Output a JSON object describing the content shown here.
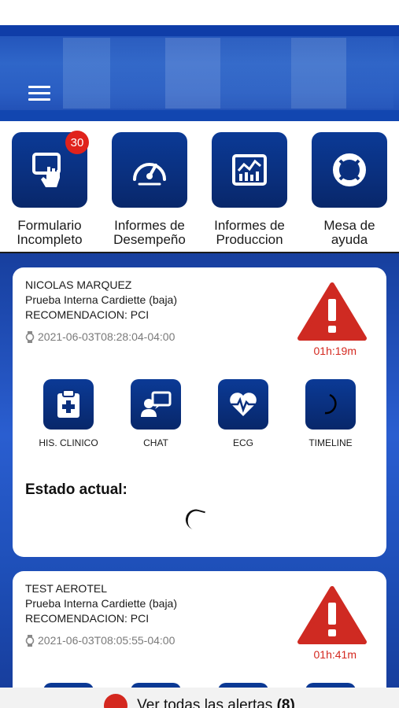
{
  "header": {
    "menu_icon": "hamburger-menu-icon"
  },
  "quick_actions": [
    {
      "label_line1": "Formulario",
      "label_line2": "Incompleto",
      "icon": "touch-form-icon",
      "badge": "30"
    },
    {
      "label_line1": "Informes de",
      "label_line2": "Desempeño",
      "icon": "speedometer-icon"
    },
    {
      "label_line1": "Informes de",
      "label_line2": "Produccion",
      "icon": "chart-icon"
    },
    {
      "label_line1": "Mesa de",
      "label_line2": "ayuda",
      "icon": "lifebuoy-icon"
    }
  ],
  "alerts": [
    {
      "name": "NICOLAS MARQUEZ",
      "test": "Prueba Interna Cardiette (baja)",
      "recommendation": "RECOMENDACION: PCI",
      "timestamp": "2021-06-03T08:28:04-04:00",
      "elapsed": "01h:19m",
      "actions": [
        {
          "label": "HIS. CLINICO",
          "icon": "clipboard-plus-icon"
        },
        {
          "label": "CHAT",
          "icon": "chat-user-icon"
        },
        {
          "label": "ECG",
          "icon": "heart-pulse-icon"
        },
        {
          "label": "TIMELINE",
          "icon": "timeline-loading-icon"
        }
      ],
      "status_label": "Estado actual:"
    },
    {
      "name": "TEST AEROTEL",
      "test": "Prueba Interna Cardiette (baja)",
      "recommendation": "RECOMENDACION: PCI",
      "timestamp": "2021-06-03T08:05:55-04:00",
      "elapsed": "01h:41m"
    }
  ],
  "bottom_bar": {
    "text": "Ver todas las alertas",
    "count": "(8)"
  },
  "colors": {
    "brand_blue": "#0b3a96",
    "alert_red": "#d4281f",
    "badge_red": "#e0221b"
  }
}
